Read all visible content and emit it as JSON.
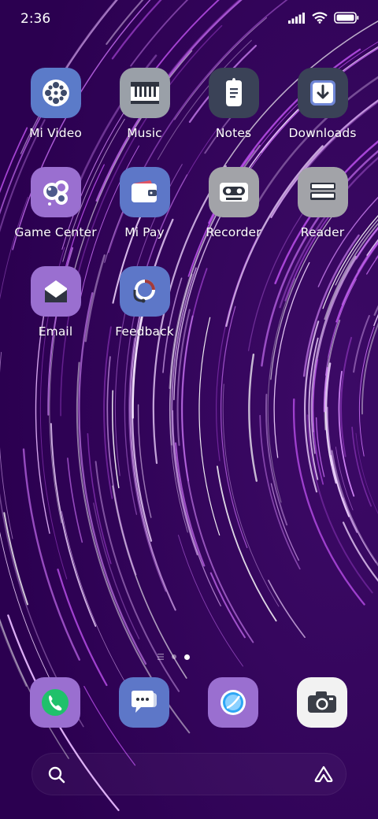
{
  "status_bar": {
    "time": "2:36"
  },
  "apps": [
    {
      "label": "Mi Video",
      "icon": "film-reel-icon",
      "color": "#5b7bc9"
    },
    {
      "label": "Music",
      "icon": "piano-keys-icon",
      "color": "#9aa0a8"
    },
    {
      "label": "Notes",
      "icon": "note-icon",
      "color": "#3a4257"
    },
    {
      "label": "Downloads",
      "icon": "download-icon",
      "color": "#3a4257"
    },
    {
      "label": "Game Center",
      "icon": "bubbles-icon",
      "color": "#9a6fd0"
    },
    {
      "label": "Mi Pay",
      "icon": "wallet-icon",
      "color": "#5d77c8"
    },
    {
      "label": "Recorder",
      "icon": "cassette-icon",
      "color": "#a2a3a8"
    },
    {
      "label": "Reader",
      "icon": "books-icon",
      "color": "#a2a3a8"
    },
    {
      "label": "Email",
      "icon": "envelope-icon",
      "color": "#9a6fd0"
    },
    {
      "label": "Feedback",
      "icon": "headset-icon",
      "color": "#5d77c8"
    }
  ],
  "dock": [
    {
      "name": "phone",
      "icon": "phone-icon",
      "color": "#9a6fd0"
    },
    {
      "name": "messaging",
      "icon": "chat-bubble-icon",
      "color": "#5d77c8"
    },
    {
      "name": "browser",
      "icon": "browser-icon",
      "color": "#9a6fd0"
    },
    {
      "name": "camera",
      "icon": "camera-icon",
      "color": "#f2f2f2"
    }
  ],
  "pages": {
    "count": 2,
    "current": 2
  },
  "search_bar": {
    "left_icon": "search-icon",
    "right_icon": "assistant-icon"
  }
}
